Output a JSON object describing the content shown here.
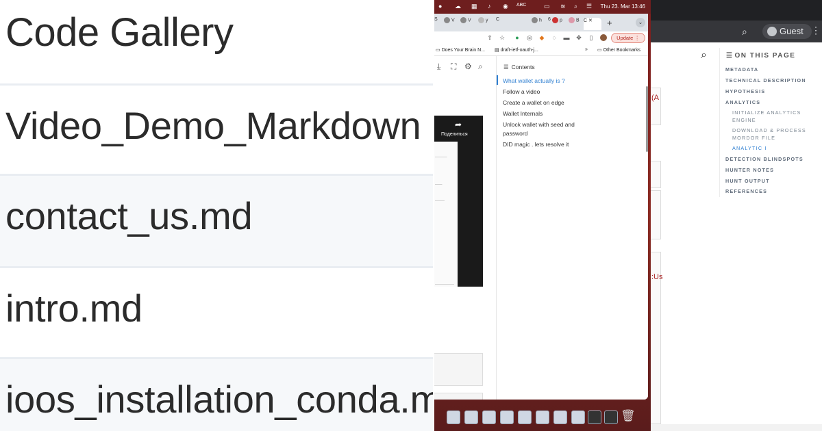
{
  "left": {
    "title": "Code Gallery",
    "files": [
      "Video_Demo_Markdown",
      "contact_us.md",
      "intro.md",
      "ioos_installation_conda.md"
    ]
  },
  "macos": {
    "clock": "Thu 23. Mar  13:46",
    "input_source": "ABC",
    "tabs": [
      "S",
      "V",
      "V",
      "y",
      "C",
      "h",
      "6",
      "p",
      "B",
      "C"
    ],
    "update_label": "Update",
    "bookmarks": [
      "Does Your Brain N...",
      "draft-ietf-oauth-j...",
      "Other Bookmarks"
    ],
    "bookmark_overflow": "»",
    "video_share_label": "Поделиться",
    "contents_header": "Contents",
    "contents": [
      "What wallet actually is ?",
      "Follow a video",
      "Create a wallet on edge",
      "Wallet Internals",
      "Unlock wallet with seed and",
      "password",
      "DID magic . lets resolve it"
    ]
  },
  "docs": {
    "guest_label": "Guest",
    "on_this_page": "ON THIS PAGE",
    "sections": [
      {
        "label": "METADATA",
        "level": 1,
        "active": false
      },
      {
        "label": "TECHNICAL DESCRIPTION",
        "level": 1,
        "active": false
      },
      {
        "label": "HYPOTHESIS",
        "level": 1,
        "active": false
      },
      {
        "label": "ANALYTICS",
        "level": 1,
        "active": false
      },
      {
        "label": "INITIALIZE ANALYTICS",
        "level": 2,
        "active": false
      },
      {
        "label": "ENGINE",
        "level": 2,
        "active": false
      },
      {
        "label": "DOWNLOAD & PROCESS",
        "level": 2,
        "active": false
      },
      {
        "label": "MORDOR FILE",
        "level": 2,
        "active": false
      },
      {
        "label": "ANALYTIC I",
        "level": 2,
        "active": true
      },
      {
        "label": "DETECTION BLINDSPOTS",
        "level": 1,
        "active": false
      },
      {
        "label": "HUNTER NOTES",
        "level": 1,
        "active": false
      },
      {
        "label": "HUNT OUTPUT",
        "level": 1,
        "active": false
      },
      {
        "label": "REFERENCES",
        "level": 1,
        "active": false
      }
    ],
    "fragments": [
      "(A",
      ":Us"
    ]
  }
}
